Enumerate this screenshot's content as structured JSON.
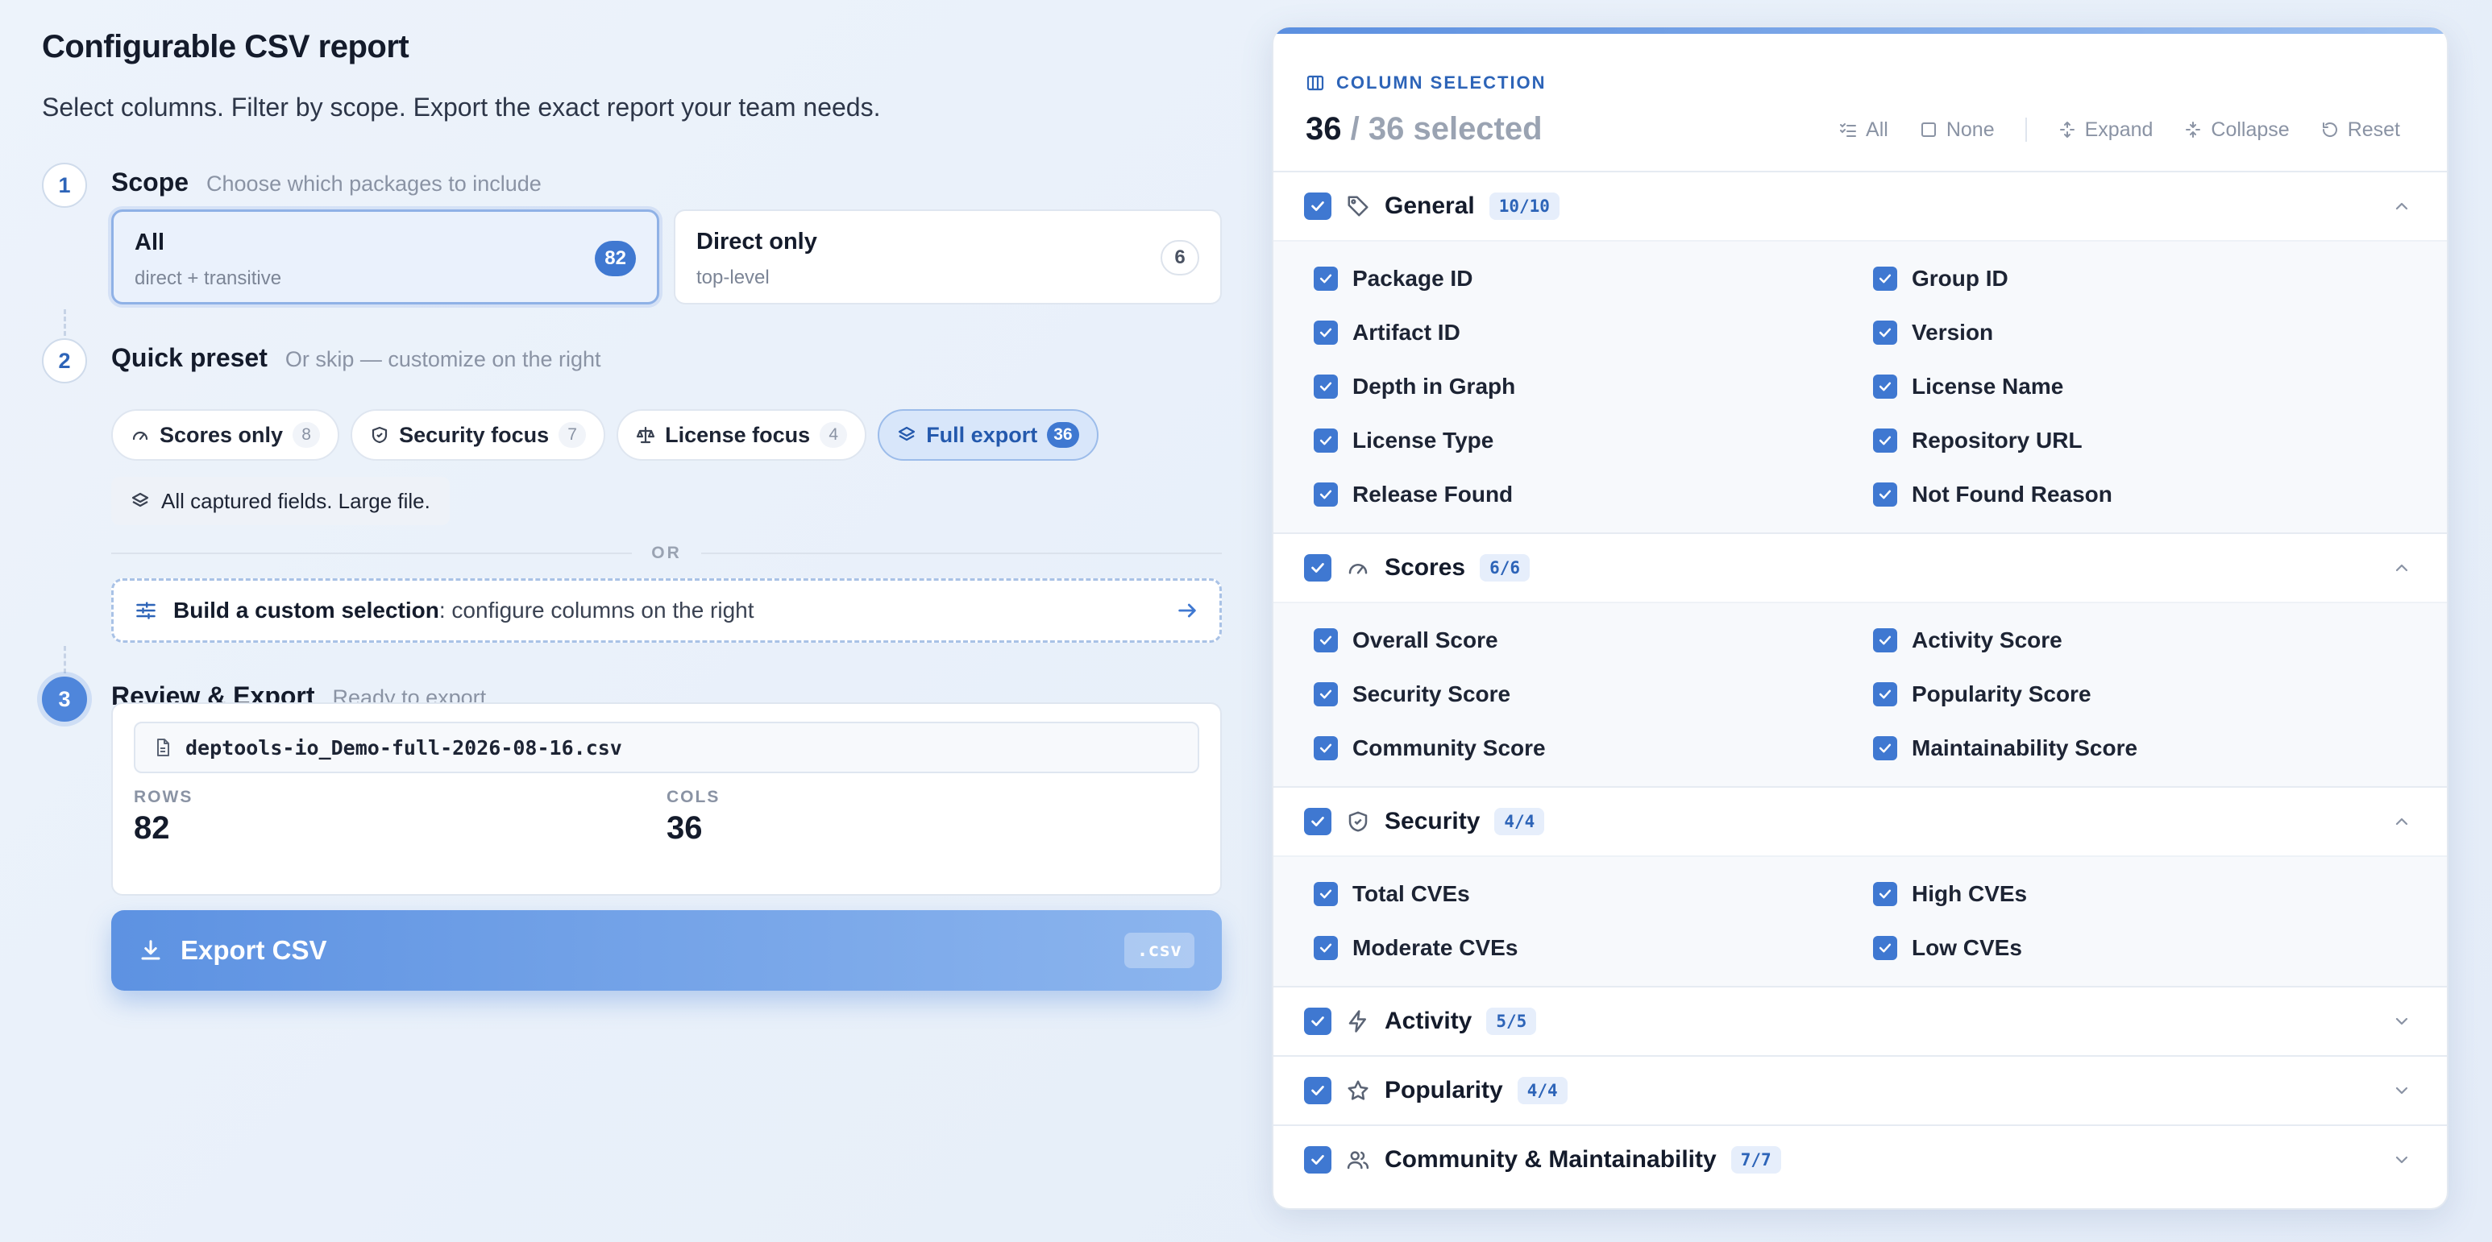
{
  "page": {
    "title": "Configurable CSV report",
    "subtitle": "Select columns. Filter by scope. Export the exact report your team needs."
  },
  "steps": [
    {
      "number": "1",
      "title": "Scope",
      "hint": "Choose which packages to include"
    },
    {
      "number": "2",
      "title": "Quick preset",
      "hint": "Or skip — customize on the right"
    },
    {
      "number": "3",
      "title": "Review & Export",
      "hint": "Ready to export"
    }
  ],
  "scope": {
    "options": [
      {
        "name": "All",
        "desc": "direct + transitive",
        "count": "82",
        "selected": true
      },
      {
        "name": "Direct only",
        "desc": "top-level",
        "count": "6",
        "selected": false
      }
    ]
  },
  "presets": {
    "items": [
      {
        "label": "Scores only",
        "count": "8",
        "icon": "gauge-icon"
      },
      {
        "label": "Security focus",
        "count": "7",
        "icon": "shield-icon"
      },
      {
        "label": "License focus",
        "count": "4",
        "icon": "scale-icon"
      },
      {
        "label": "Full export",
        "count": "36",
        "icon": "layers-icon",
        "active": true
      }
    ],
    "note": "All captured fields. Large file.",
    "or_label": "OR",
    "custom_bold": "Build a custom selection",
    "custom_rest": ": configure columns on the right"
  },
  "review": {
    "filename": "deptools-io_Demo-full-2026-08-16.csv",
    "rows_label": "ROWS",
    "rows_value": "82",
    "cols_label": "COLS",
    "cols_value": "36",
    "export_label": "Export CSV",
    "export_ext": ".csv"
  },
  "panel": {
    "kicker": "COLUMN SELECTION",
    "selected_count": "36",
    "total_text": "/ 36 selected",
    "toolbar": {
      "all": "All",
      "none": "None",
      "expand": "Expand",
      "collapse": "Collapse",
      "reset": "Reset"
    },
    "groups": [
      {
        "name": "General",
        "badge": "10/10",
        "icon": "tag-icon",
        "expanded": true,
        "fields": [
          "Package ID",
          "Group ID",
          "Artifact ID",
          "Version",
          "Depth in Graph",
          "License Name",
          "License Type",
          "Repository URL",
          "Release Found",
          "Not Found Reason"
        ]
      },
      {
        "name": "Scores",
        "badge": "6/6",
        "icon": "gauge-icon",
        "expanded": true,
        "fields": [
          "Overall Score",
          "Activity Score",
          "Security Score",
          "Popularity Score",
          "Community Score",
          "Maintainability Score"
        ]
      },
      {
        "name": "Security",
        "badge": "4/4",
        "icon": "shield-icon",
        "expanded": true,
        "fields": [
          "Total CVEs",
          "High CVEs",
          "Moderate CVEs",
          "Low CVEs"
        ]
      },
      {
        "name": "Activity",
        "badge": "5/5",
        "icon": "bolt-icon",
        "expanded": false,
        "fields": []
      },
      {
        "name": "Popularity",
        "badge": "4/4",
        "icon": "star-icon",
        "expanded": false,
        "fields": []
      },
      {
        "name": "Community & Maintainability",
        "badge": "7/7",
        "icon": "users-icon",
        "expanded": false,
        "fields": []
      }
    ]
  },
  "colors": {
    "accent": "#3f78d1",
    "accent_light": "#d8e6fa",
    "text": "#141b2b",
    "muted": "#8a93a4",
    "background": "#eaf0f8"
  }
}
